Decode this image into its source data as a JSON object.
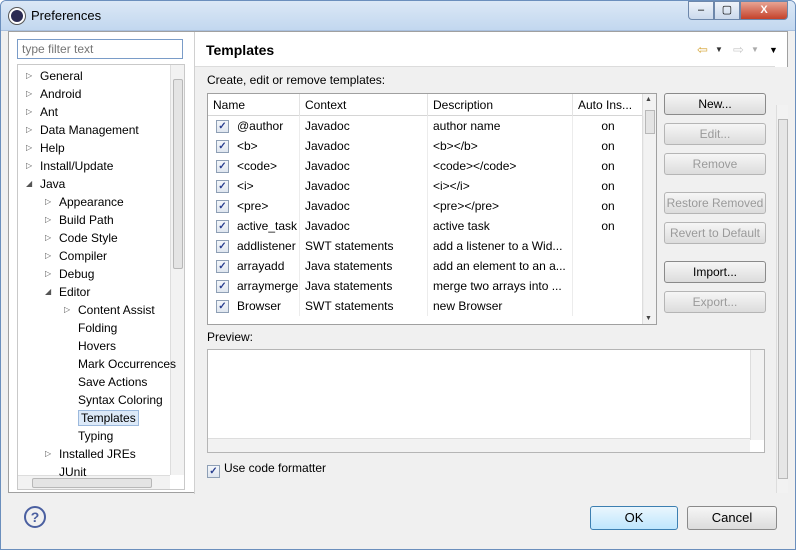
{
  "window": {
    "title": "Preferences"
  },
  "filter": {
    "placeholder": "type filter text"
  },
  "tree": [
    {
      "label": "General",
      "arrow": "▷"
    },
    {
      "label": "Android",
      "arrow": "▷"
    },
    {
      "label": "Ant",
      "arrow": "▷"
    },
    {
      "label": "Data Management",
      "arrow": "▷"
    },
    {
      "label": "Help",
      "arrow": "▷"
    },
    {
      "label": "Install/Update",
      "arrow": "▷"
    },
    {
      "label": "Java",
      "arrow": "◢"
    },
    {
      "label": "Appearance",
      "arrow": "▷"
    },
    {
      "label": "Build Path",
      "arrow": "▷"
    },
    {
      "label": "Code Style",
      "arrow": "▷"
    },
    {
      "label": "Compiler",
      "arrow": "▷"
    },
    {
      "label": "Debug",
      "arrow": "▷"
    },
    {
      "label": "Editor",
      "arrow": "◢"
    },
    {
      "label": "Content Assist",
      "arrow": "▷"
    },
    {
      "label": "Folding",
      "arrow": ""
    },
    {
      "label": "Hovers",
      "arrow": ""
    },
    {
      "label": "Mark Occurrences",
      "arrow": ""
    },
    {
      "label": "Save Actions",
      "arrow": ""
    },
    {
      "label": "Syntax Coloring",
      "arrow": ""
    },
    {
      "label": "Templates",
      "arrow": ""
    },
    {
      "label": "Typing",
      "arrow": ""
    },
    {
      "label": "Installed JREs",
      "arrow": "▷"
    },
    {
      "label": "JUnit",
      "arrow": ""
    }
  ],
  "page": {
    "title": "Templates",
    "create_label": "Create, edit or remove templates:",
    "preview_label": "Preview:",
    "use_formatter_label": "Use code formatter"
  },
  "table": {
    "headers": [
      "Name",
      "Context",
      "Description",
      "Auto Ins..."
    ],
    "rows": [
      {
        "name": "@author",
        "context": "Javadoc",
        "description": "author name",
        "auto": "on"
      },
      {
        "name": "<b>",
        "context": "Javadoc",
        "description": "<b></b>",
        "auto": "on"
      },
      {
        "name": "<code>",
        "context": "Javadoc",
        "description": "<code></code>",
        "auto": "on"
      },
      {
        "name": "<i>",
        "context": "Javadoc",
        "description": "<i></i>",
        "auto": "on"
      },
      {
        "name": "<pre>",
        "context": "Javadoc",
        "description": "<pre></pre>",
        "auto": "on"
      },
      {
        "name": "active_task",
        "context": "Javadoc",
        "description": "active task",
        "auto": "on"
      },
      {
        "name": "addlistener",
        "context": "SWT statements",
        "description": "add a listener to a Wid...",
        "auto": ""
      },
      {
        "name": "arrayadd",
        "context": "Java statements",
        "description": "add an element to an a...",
        "auto": ""
      },
      {
        "name": "arraymerge",
        "context": "Java statements",
        "description": "merge two arrays into ...",
        "auto": ""
      },
      {
        "name": "Browser",
        "context": "SWT statements",
        "description": "new Browser",
        "auto": ""
      }
    ]
  },
  "buttons": {
    "new": "New...",
    "edit": "Edit...",
    "remove": "Remove",
    "restore": "Restore Removed",
    "revert": "Revert to Default",
    "import": "Import...",
    "export": "Export..."
  },
  "footer": {
    "ok": "OK",
    "cancel": "Cancel"
  },
  "window_buttons": {
    "close": "X"
  }
}
